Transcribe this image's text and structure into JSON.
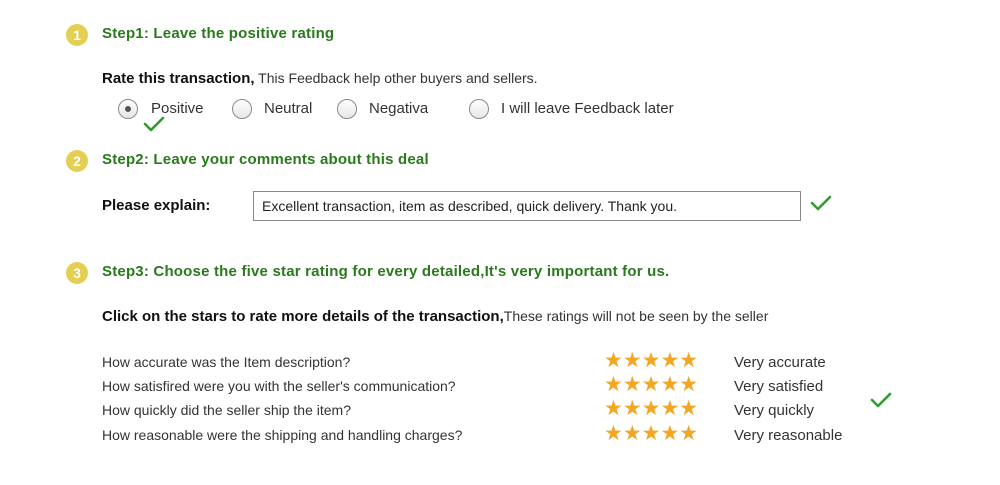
{
  "step1": {
    "badge": "1",
    "title": "Step1: Leave the positive rating",
    "prompt_bold": "Rate this transaction,",
    "prompt_normal": " This Feedback help other buyers and sellers.",
    "options": [
      {
        "label": "Positive",
        "selected": true
      },
      {
        "label": "Neutral",
        "selected": false
      },
      {
        "label": "Negativa",
        "selected": false
      },
      {
        "label": "I will leave Feedback later",
        "selected": false
      }
    ]
  },
  "step2": {
    "badge": "2",
    "title": "Step2: Leave your comments about this deal",
    "field_label": "Please explain:",
    "field_value": "Excellent transaction, item as described, quick delivery. Thank you."
  },
  "step3": {
    "badge": "3",
    "title": "Step3: Choose the five star rating for every detailed,It's very important for us.",
    "instr_bold": "Click on the stars to rate more details of the transaction,",
    "instr_normal": "These ratings will not be seen by the seller",
    "ratings": [
      {
        "question": "How accurate was the Item description?",
        "stars": "★★★★★",
        "label": "Very accurate",
        "value": 5
      },
      {
        "question": "How satisfired were you with the seller's communication?",
        "stars": "★★★★★",
        "label": "Very satisfied",
        "value": 5
      },
      {
        "question": "How quickly did the seller ship the item?",
        "stars": "★★★★★",
        "label": "Very quickly",
        "value": 5
      },
      {
        "question": "How reasonable were the shipping and handling charges?",
        "stars": "★★★★★",
        "label": "Very reasonable",
        "value": 5
      }
    ]
  },
  "colors": {
    "step_title": "#2a7a1d",
    "badge": "#e4cf52",
    "star": "#f3a623",
    "checkmark": "#2e9e2e"
  }
}
